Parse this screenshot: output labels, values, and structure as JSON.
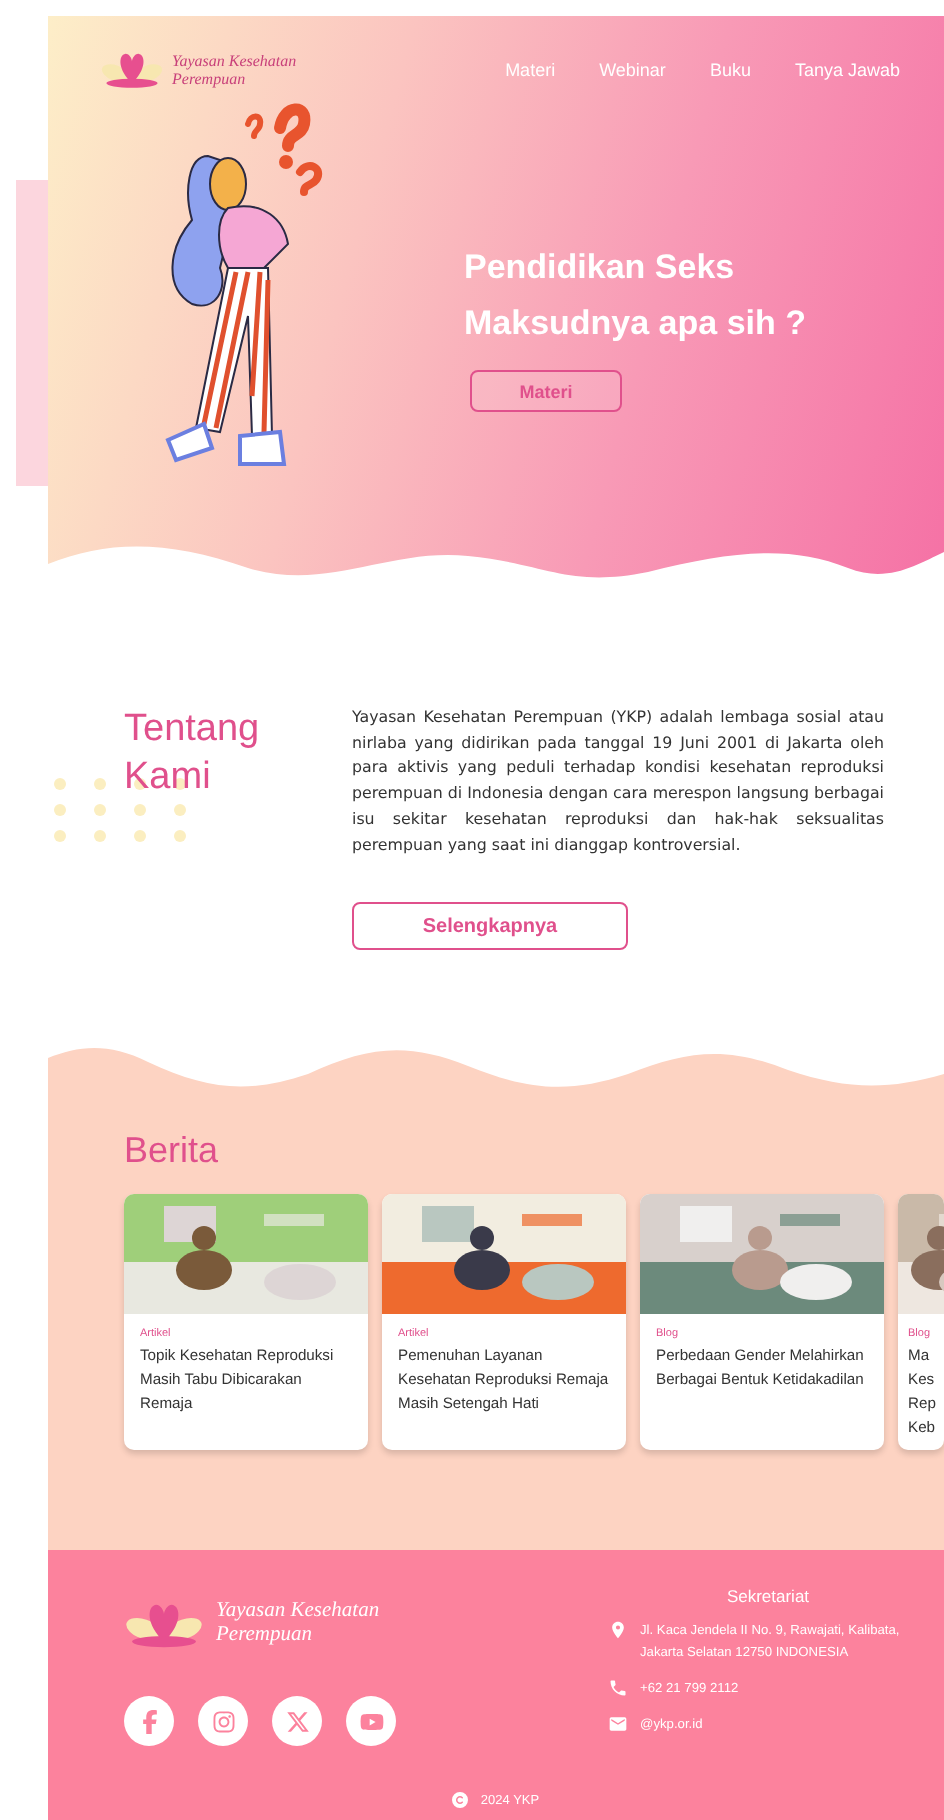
{
  "header": {
    "logo_text": "Yayasan Kesehatan Perempuan",
    "nav": [
      {
        "label": "Materi"
      },
      {
        "label": "Webinar"
      },
      {
        "label": "Buku"
      },
      {
        "label": "Tanya Jawab"
      }
    ]
  },
  "hero": {
    "title": "Pendidikan Seks Maksudnya apa sih ?",
    "button": "Materi"
  },
  "about": {
    "heading": "Tentang Kami",
    "body": "Yayasan Kesehatan Perempuan (YKP) adalah lembaga sosial atau nirlaba yang didirikan pada tanggal 19 Juni 2001 di Jakarta oleh para aktivis yang peduli terhadap kondisi kesehatan reproduksi perempuan di Indonesia dengan cara merespon langsung berbagai isu sekitar kesehatan reproduksi dan hak-hak seksualitas perempuan yang saat ini dianggap kontroversial.",
    "button": "Selengkapnya"
  },
  "news": {
    "heading": "Berita",
    "cards": [
      {
        "kind": "full",
        "category": "Artikel",
        "title": "Topik Kesehatan Reproduksi Masih Tabu Dibicarakan Remaja"
      },
      {
        "kind": "full",
        "category": "Artikel",
        "title": "Pemenuhan Layanan Kesehatan Reproduksi Remaja Masih Setengah Hati"
      },
      {
        "kind": "full",
        "category": "Blog",
        "title": "Perbedaan Gender Melahirkan Berbagai Bentuk Ketidakadilan"
      },
      {
        "kind": "clipped",
        "category": "Blog",
        "title": "Ma Kes Rep Keb"
      }
    ]
  },
  "footer": {
    "brand": "Yayasan Kesehatan Perempuan",
    "socials": [
      {
        "kind": "facebook"
      },
      {
        "kind": "instagram"
      },
      {
        "kind": "x"
      },
      {
        "kind": "youtube"
      }
    ],
    "contact_heading": "Sekretariat",
    "contacts": [
      {
        "kind": "address",
        "text": "Jl. Kaca Jendela II No. 9, Rawajati, Kalibata, Jakarta Selatan 12750 INDONESIA"
      },
      {
        "kind": "phone",
        "text": "+62 21 799 2112"
      },
      {
        "kind": "email",
        "text": "@ykp.or.id"
      }
    ],
    "copyright": "2024 YKP"
  }
}
